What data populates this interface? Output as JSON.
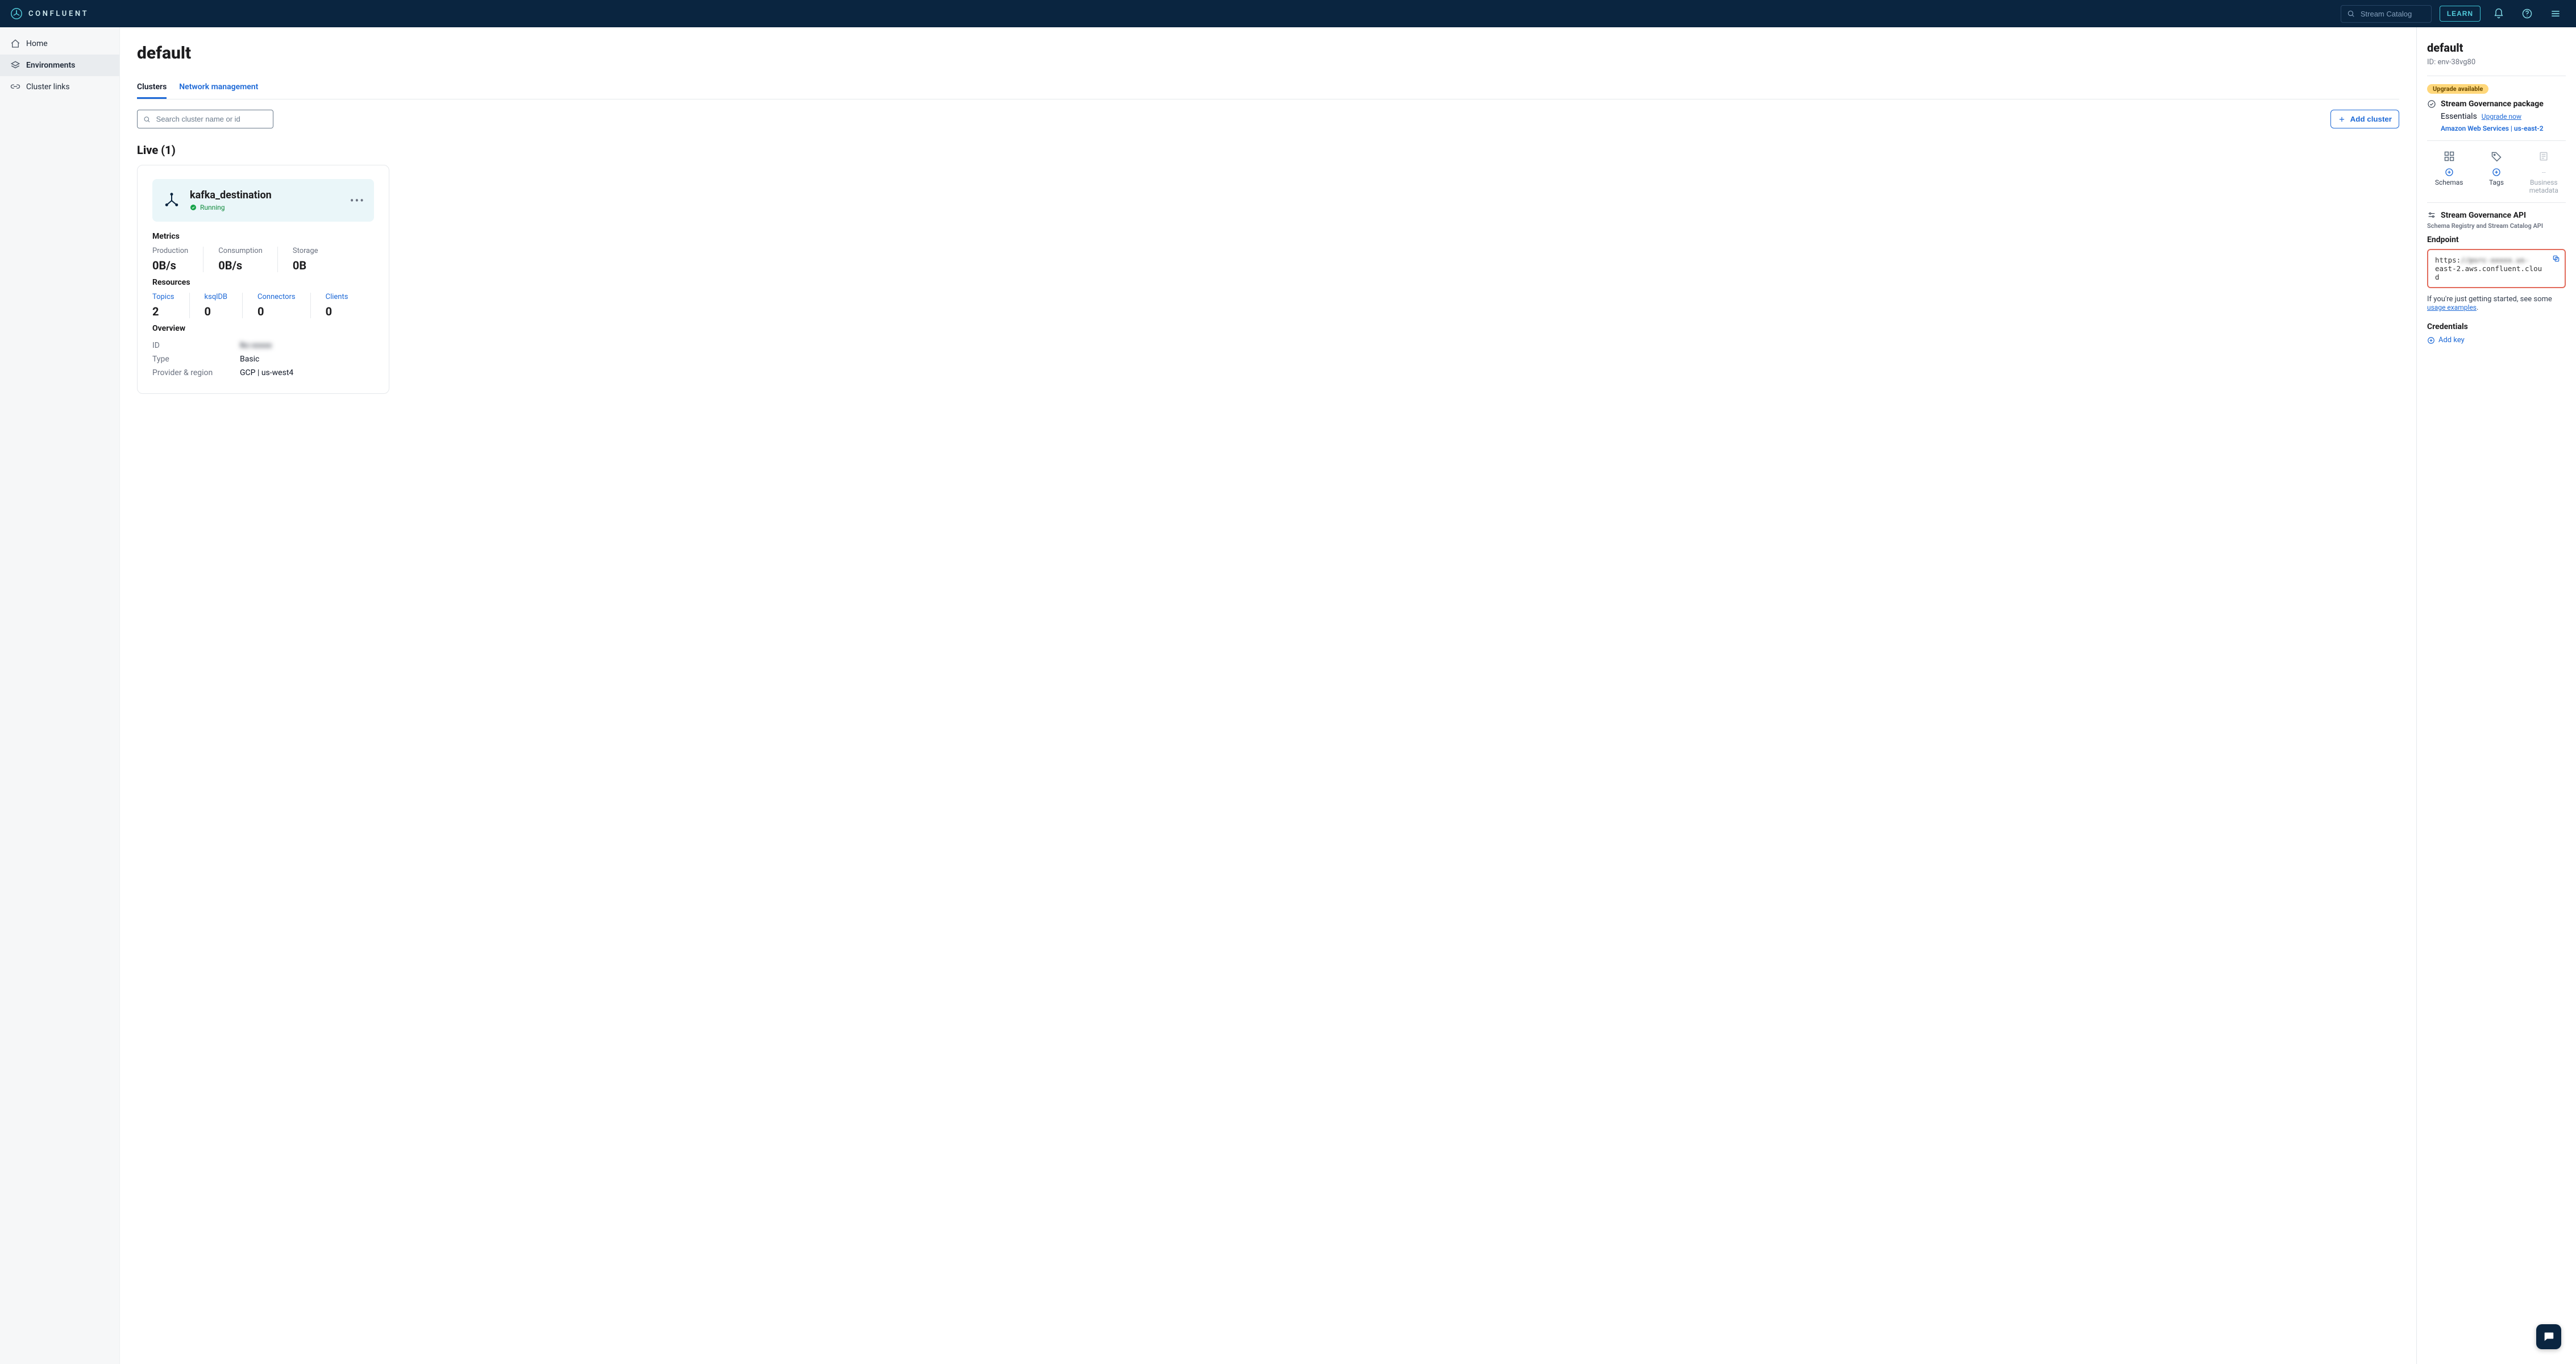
{
  "brand": {
    "name": "CONFLUENT"
  },
  "topnav": {
    "search_placeholder": "Stream Catalog",
    "learn": "LEARN"
  },
  "sidebar": {
    "items": [
      {
        "id": "home",
        "label": "Home"
      },
      {
        "id": "environments",
        "label": "Environments"
      },
      {
        "id": "cluster-links",
        "label": "Cluster links"
      }
    ]
  },
  "page": {
    "title": "default",
    "tabs": {
      "clusters": "Clusters",
      "network": "Network management"
    },
    "cluster_search_placeholder": "Search cluster name or id",
    "add_cluster": "Add cluster",
    "live_heading": "Live (1)"
  },
  "cluster": {
    "name": "kafka_destination",
    "status": "Running",
    "metrics_heading": "Metrics",
    "metrics": {
      "production": {
        "label": "Production",
        "value": "0B/s"
      },
      "consumption": {
        "label": "Consumption",
        "value": "0B/s"
      },
      "storage": {
        "label": "Storage",
        "value": "0B"
      }
    },
    "resources_heading": "Resources",
    "resources": {
      "topics": {
        "label": "Topics",
        "value": "2"
      },
      "ksqldb": {
        "label": "ksqlDB",
        "value": "0"
      },
      "connectors": {
        "label": "Connectors",
        "value": "0"
      },
      "clients": {
        "label": "Clients",
        "value": "0"
      }
    },
    "overview_heading": "Overview",
    "overview": {
      "id_label": "ID",
      "id_value": "lkc-xxxxx",
      "type_label": "Type",
      "type_value": "Basic",
      "provider_label": "Provider & region",
      "provider_value": "GCP | us-west4"
    }
  },
  "right": {
    "env_title": "default",
    "env_id_label": "ID:",
    "env_id": "env-38vg80",
    "upgrade_chip": "Upgrade available",
    "governance_pkg": "Stream Governance package",
    "plan": "Essentials",
    "upgrade_now": "Upgrade now",
    "region": "Amazon Web Services | us-east-2",
    "features": {
      "schemas": "Schemas",
      "tags": "Tags",
      "business": "Business metadata"
    },
    "api_section": "Stream Governance API",
    "api_desc": "Schema Registry and Stream Catalog API",
    "endpoint_label": "Endpoint",
    "endpoint_prefix": "https:",
    "endpoint_blur": "//psrc-xxxxx.us-",
    "endpoint_rest": "east-2.aws.confluent.cloud",
    "note_prefix": "If you're just getting started, see some ",
    "note_link": "usage examples",
    "note_suffix": ".",
    "credentials": "Credentials",
    "add_key": "Add key"
  }
}
